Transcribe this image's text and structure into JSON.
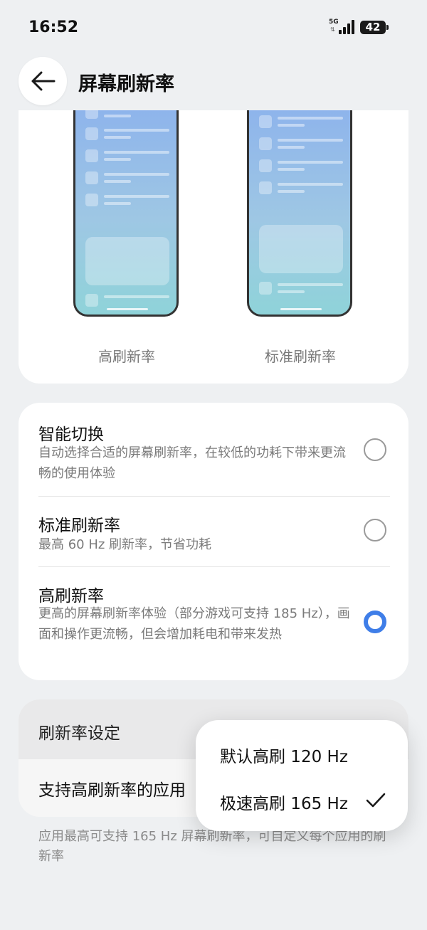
{
  "status_bar": {
    "time": "16:52",
    "network": "5G",
    "battery": "42"
  },
  "header": {
    "title": "屏幕刷新率",
    "back_icon": "back-arrow-icon"
  },
  "preview": {
    "high_label": "高刷新率",
    "standard_label": "标准刷新率"
  },
  "options": [
    {
      "title": "智能切换",
      "description": "自动选择合适的屏幕刷新率，在较低的功耗下带来更流畅的使用体验",
      "selected": false
    },
    {
      "title": "标准刷新率",
      "description": "最高 60 Hz 刷新率，节省功耗",
      "selected": false
    },
    {
      "title": "高刷新率",
      "description": "更高的屏幕刷新率体验（部分游戏可支持 185 Hz），画面和操作更流畅，但会增加耗电和带来发热",
      "selected": true
    }
  ],
  "refresh_setting": {
    "section_label": "刷新率设定",
    "apps_row_label": "支持高刷新率的应用",
    "footnote": "应用最高可支持 165 Hz 屏幕刷新率，可自定义每个应用的刷新率"
  },
  "popup": {
    "items": [
      {
        "label": "默认高刷 120 Hz",
        "checked": false
      },
      {
        "label": "极速高刷 165 Hz",
        "checked": true
      }
    ]
  },
  "colors": {
    "accent": "#3f7ee8",
    "background": "#eef0f2"
  }
}
